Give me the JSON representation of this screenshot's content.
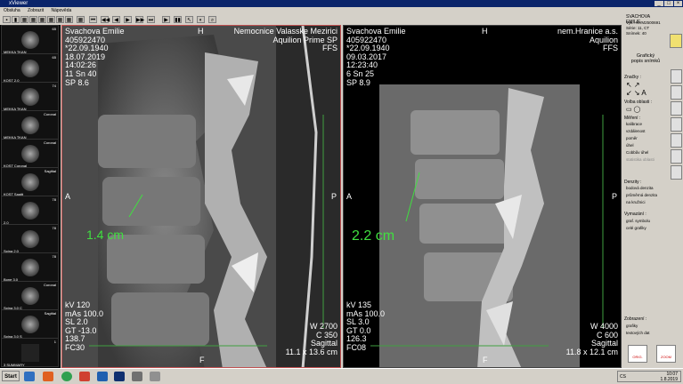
{
  "window": {
    "title": "xViewer"
  },
  "menu": [
    "Obsluha",
    "Zobrazit",
    "Nápověda"
  ],
  "thumbnails": [
    {
      "label": "MEKKA TKAN",
      "num": "65"
    },
    {
      "label": "KOST 2.0",
      "num": "65"
    },
    {
      "label": "MEKKA TKAN",
      "num": "74"
    },
    {
      "label": "MEKKA TKAN",
      "num": "Coronal"
    },
    {
      "label": "KOST Coronal",
      "num": "Coronal"
    },
    {
      "label": "KOST Sagitt",
      "num": "Sagittal"
    },
    {
      "label": "2.0",
      "num": "78"
    },
    {
      "label": "Spina 2.0",
      "num": "78"
    },
    {
      "label": "Bone 3.0",
      "num": "78"
    },
    {
      "label": "Spina 3.0 C",
      "num": "Coronal"
    },
    {
      "label": "Spina 3.0 S",
      "num": "Sagittal"
    },
    {
      "label": "3 SUMMARY",
      "num": "1"
    }
  ],
  "left_view": {
    "tl": "Svachova Emilie\n405922470\n*22.09.1940\n18.07.2019\n14:02:26\n11 Sn 40\nSP 8.6",
    "top": "H",
    "tr": "Nemocnice Valasske Mezirici\nAquilion Prime SP\nFFS",
    "left": "A",
    "right": "P",
    "measure": "1.4 cm",
    "bl": "kV 120\nmAs 100.0\nSL 2.0\nGT -13.0\n138.7\nFC30",
    "bottom": "F",
    "br": "W 2700\nC 350\nSagittal\n11.1 x 13.6 cm"
  },
  "right_view": {
    "tl": "Svachova Emilie\n405922470\n*22.09.1940\n09.03.2017\n12:23:40\n6 Sn 25\nSP 8.9",
    "top": "H",
    "tr": "nem.Hranice a.s.\nAquilion\nFFS",
    "left": "A",
    "right": "P",
    "measure": "2.2 cm",
    "bl": "kV 135\nmAs 100.0\nSL 3.0\nGT 0.0\n126.3\nFC08",
    "bottom": "F",
    "br": "W 4000\nC 600\nSagittal\n11.8 x 12.1 cm"
  },
  "side_panel": {
    "patient": "SVACHOVA EMILIE",
    "vyk": "Vyk.: NVM2500691",
    "serie": "Série: 11, CT",
    "snimek": "Snímek: 40",
    "graphic_title": "Grafický\npopis snímků",
    "znacky": "Značky :",
    "volba": "Volba oblasti :",
    "mereni": "Měření :",
    "mereni_items": [
      "kalibrace",
      "vzdálenost",
      "poměr",
      "úhel",
      "Cobbův úhel",
      "statistika oblasti"
    ],
    "denzity": "Denzity :",
    "denzity_items": [
      "bodová denzita",
      "průměrná denzita",
      "na kružnici"
    ],
    "vymazani": "Vymazání :",
    "vymazani_items": [
      "graf. symbolu",
      "celé grafiky"
    ],
    "zobrazeni": "Zobrazení :",
    "zobrazeni_items": [
      "grafiky",
      "textových dat"
    ],
    "orig": "ORIG.",
    "fuzz": "ZOOM"
  },
  "taskbar": {
    "start": "Start",
    "lang": "CS",
    "time": "10:07",
    "date": "1.8.2019"
  }
}
